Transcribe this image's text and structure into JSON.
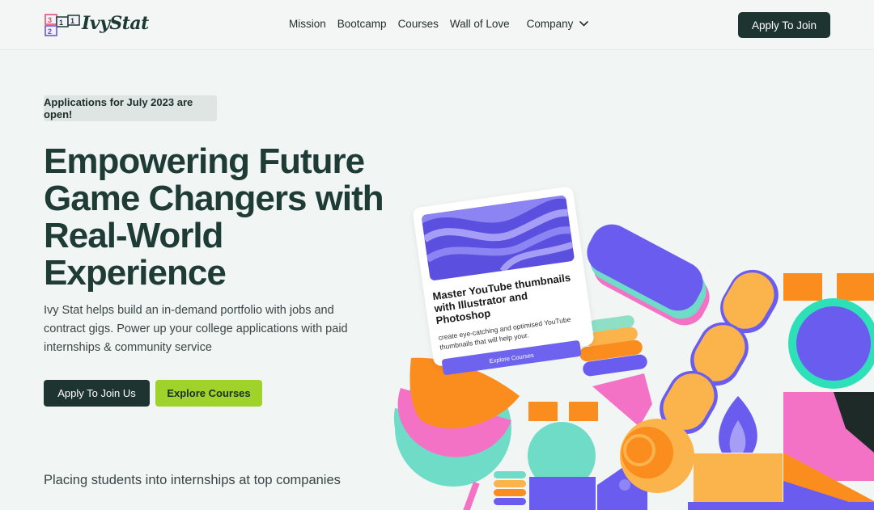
{
  "brand": {
    "name": "IvyStat",
    "logo_digits": [
      "3",
      "1",
      "1",
      "2"
    ]
  },
  "nav": {
    "items": [
      "Mission",
      "Bootcamp",
      "Courses",
      "Wall of Love"
    ],
    "company": "Company"
  },
  "header": {
    "cta": "Apply To Join"
  },
  "hero": {
    "badge": "Applications for July 2023 are open!",
    "title_lines": [
      "Empowering Future",
      "Game Changers with",
      "Real-World",
      "Experience"
    ],
    "description": "Ivy Stat helps build an in-demand portfolio with jobs and contract gigs. Power up your college applications with paid internships & community service",
    "primary_cta": "Apply To Join Us",
    "secondary_cta": "Explore Courses"
  },
  "card": {
    "title": "Master YouTube thumbnails with Illustrator and Photoshop",
    "text": "create eye-catching and optimised YouTube thumbnails that will help your.",
    "button": "Explore Courses"
  },
  "placing": "Placing students into internships at top companies",
  "colors": {
    "brand_dark": "#1d3431",
    "accent_green": "#9fd32b",
    "purple": "#5b4fe0",
    "orange": "#fb8c1e",
    "pink": "#f472c5",
    "mint": "#6fdcc7",
    "yellow": "#fbb44c"
  }
}
